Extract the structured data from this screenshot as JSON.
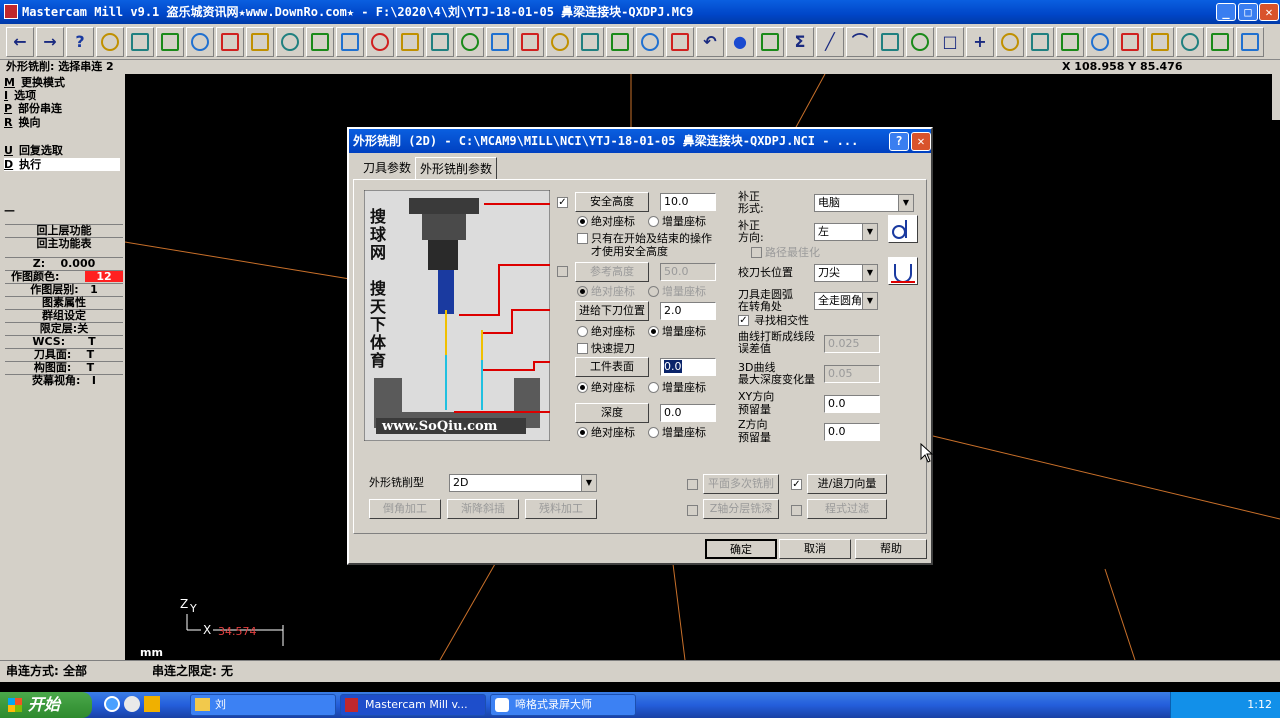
{
  "window": {
    "title": "Mastercam Mill v9.1 盗乐城资讯网★www.DownRo.com★ - F:\\2020\\4\\刘\\YTJ-18-01-05 鼻梁连接块-QXDPJ.MC9",
    "min": "_",
    "max": "□",
    "close": "✕"
  },
  "toolbar": {
    "icons": [
      "back-arrow-icon",
      "forward-arrow-icon",
      "help-icon",
      "battery-icon",
      "zoom-help-icon",
      "zoom-window-icon",
      "zoom-in-icon",
      "zoom-out-icon",
      "pan-icon",
      "select-icon",
      "rotate-icon",
      "view-top-icon",
      "view-front-icon",
      "view-side-icon",
      "view-iso-icon",
      "view-cube1-icon",
      "view-cube2-icon",
      "view-cube3-icon",
      "view-cube4-icon",
      "eraser-icon",
      "no-icon",
      "group-icon",
      "regroup-icon",
      "undo-icon",
      "sphere-icon",
      "layers-icon",
      "sigma-icon",
      "line-icon",
      "arc-icon",
      "fillet-icon",
      "spline-icon",
      "rect-icon",
      "point-icon",
      "surface-icon",
      "solid-icon",
      "chain-icon",
      "trim1-icon",
      "trim2-icon",
      "trim3-icon",
      "trim4-icon",
      "trim5-icon",
      "last-icon"
    ]
  },
  "status": {
    "prompt": "外形铣削: 选择串连 2",
    "coords": "X 108.958  Y 85.476"
  },
  "menu": {
    "items": [
      {
        "key": "M",
        "label": "更换模式"
      },
      {
        "key": "I",
        "label": "选项"
      },
      {
        "key": "P",
        "label": "部份串连"
      },
      {
        "key": "R",
        "label": "换向"
      },
      {
        "key": "U",
        "label": "回复选取"
      },
      {
        "key": "D",
        "label": "执行"
      }
    ],
    "dash": "—"
  },
  "sidebar": {
    "back": "回上层功能",
    "main": "回主功能表",
    "z_label": "Z:",
    "z_value": "0.000",
    "color_label": "作图颜色:",
    "color_value": "12",
    "level_label": "作图层别:",
    "level_value": "1",
    "attrib": "图素属性",
    "group": "群组设定",
    "limit": "限定层:关",
    "wcs_label": "WCS:",
    "wcs_value": "T",
    "tplane_label": "刀具面:",
    "tplane_value": "T",
    "cplane_label": "构图面:",
    "cplane_value": "T",
    "gview_label": "荧幕视角:",
    "gview_value": "I"
  },
  "axis": {
    "z": "Z",
    "y": "Y",
    "x": "X",
    "value": "34.574",
    "units": "mm"
  },
  "bottom": {
    "chain_method": "串连方式: 全部",
    "chain_limit": "串连之限定: 无"
  },
  "taskbar": {
    "start": "开始",
    "tasks": [
      "刘",
      "Mastercam Mill v...",
      "啼格式录屏大师"
    ],
    "time": "1:12"
  },
  "dialog": {
    "title": "外形铣削 (2D) - C:\\MCAM9\\MILL\\NCI\\YTJ-18-01-05 鼻梁连接块-QXDPJ.NCI - ...",
    "help": "?",
    "close": "✕",
    "tabs": [
      "刀具参数",
      "外形铣削参数"
    ],
    "image": {
      "watermark_v": [
        "搜",
        "球",
        "网",
        "",
        "搜",
        "天",
        "下",
        "体",
        "育"
      ],
      "url": "www.SoQiu.com"
    },
    "safe": {
      "button": "安全高度",
      "value": "10.0",
      "abs": "绝对座标",
      "inc": "增量座标",
      "note1": "只有在开始及结束的操作",
      "note2": "才使用安全高度"
    },
    "ref": {
      "button": "参考高度",
      "value": "50.0",
      "abs": "绝对座标",
      "inc": "增量座标"
    },
    "feed": {
      "button": "进给下刀位置",
      "value": "2.0",
      "abs": "绝对座标",
      "inc": "增量座标",
      "rapid": "快速提刀"
    },
    "top": {
      "button": "工件表面",
      "value": "0.0",
      "abs": "绝对座标",
      "inc": "增量座标"
    },
    "depth": {
      "button": "深度",
      "value": "0.0",
      "abs": "绝对座标",
      "inc": "增量座标"
    },
    "comp_type": {
      "label1": "补正",
      "label2": "形式:",
      "value": "电脑"
    },
    "comp_dir": {
      "label1": "补正",
      "label2": "方向:",
      "value": "左"
    },
    "optimize": "路径最佳化",
    "tip": {
      "label": "校刀长位置",
      "value": "刀尖"
    },
    "corner": {
      "label1": "刀具走圆弧",
      "label2": "在转角处",
      "value": "全走圆角"
    },
    "intersect": "寻找相交性",
    "tol": {
      "label1": "曲线打断成线段",
      "label2": "误差值",
      "value": "0.025"
    },
    "depth3d": {
      "label1": "3D曲线",
      "label2": "最大深度变化量",
      "value": "0.05"
    },
    "xy": {
      "label1": "XY方向",
      "label2": "预留量",
      "value": "0.0"
    },
    "z": {
      "label1": "Z方向",
      "label2": "预留量",
      "value": "0.0"
    },
    "contour": {
      "label": "外形铣削型",
      "value": "2D"
    },
    "btns": {
      "chamfer": "倒角加工",
      "ramp": "渐降斜插",
      "remachine": "残料加工",
      "multipass": "平面多次铣削",
      "leadin": "进/退刀向量",
      "depthcut": "Z轴分层铣深",
      "filter": "程式过滤"
    },
    "ok": "确定",
    "cancel": "取消",
    "helpbtn": "帮助"
  }
}
